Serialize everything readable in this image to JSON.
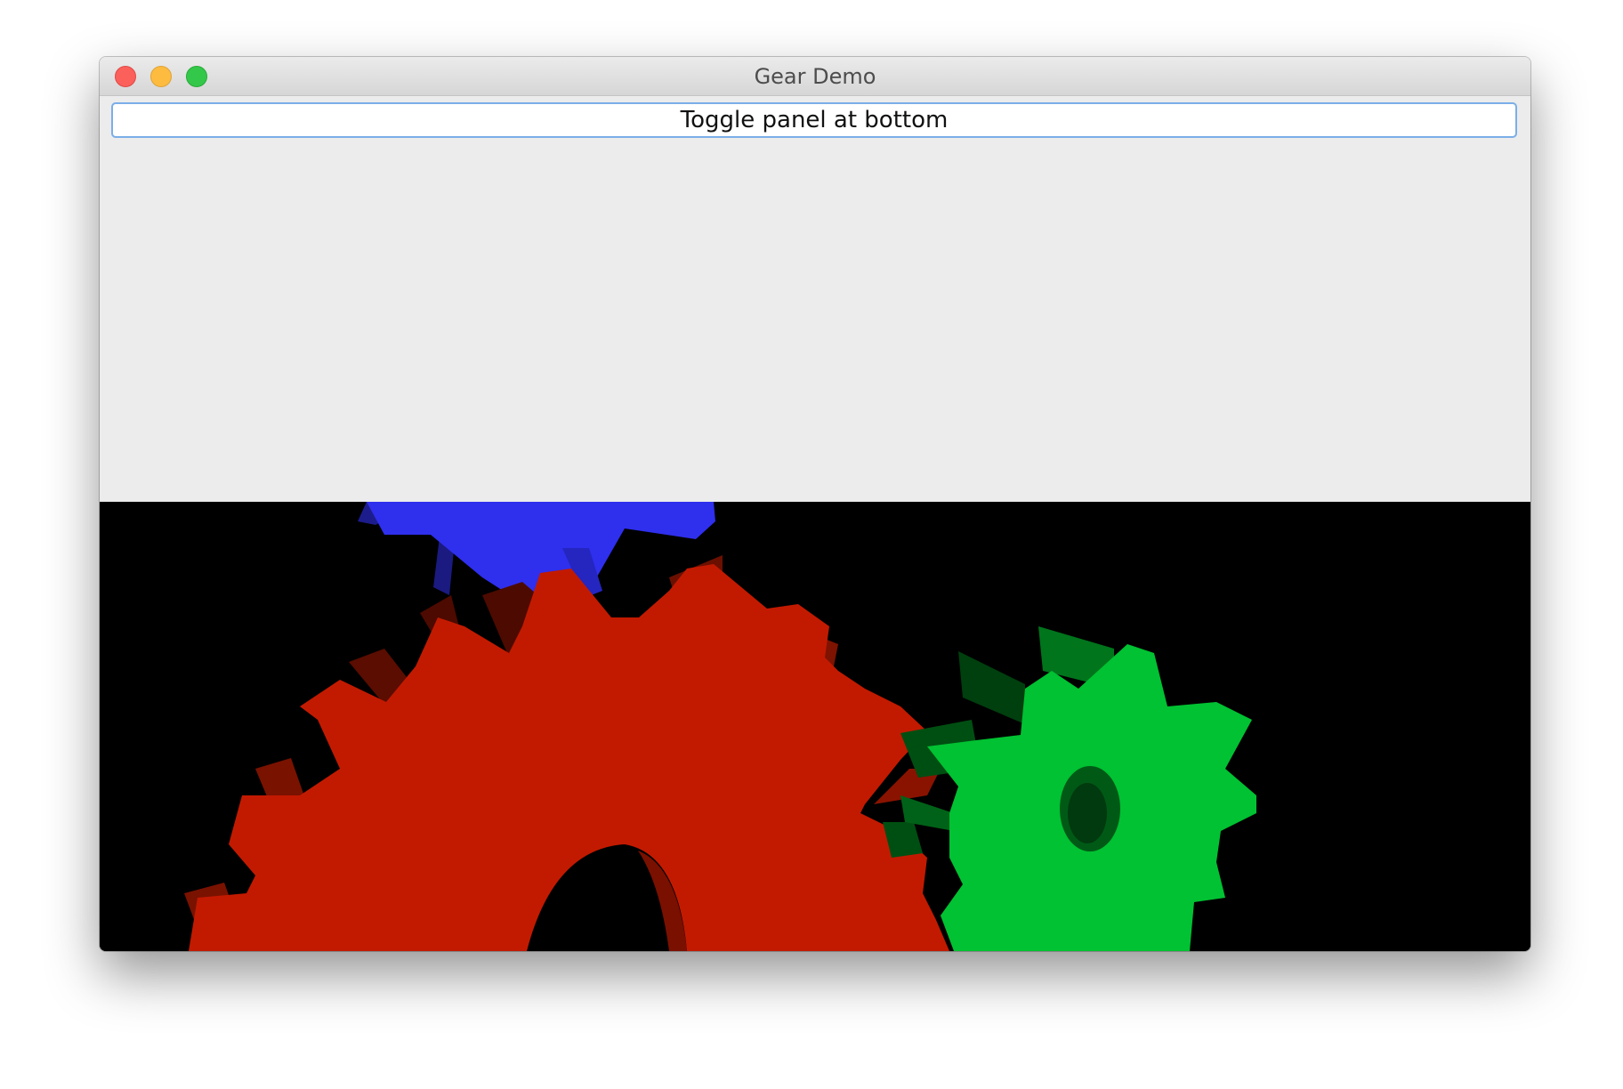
{
  "window": {
    "title": "Gear Demo",
    "controls": [
      "close",
      "minimize",
      "zoom"
    ]
  },
  "toolbar": {
    "toggle_label": "Toggle panel at bottom"
  },
  "canvas": {
    "background": "#000000",
    "gears": [
      {
        "name": "red-gear",
        "color": "#c21a00",
        "teeth": 20
      },
      {
        "name": "green-gear",
        "color": "#00c232",
        "teeth": 10
      },
      {
        "name": "blue-gear",
        "color": "#2f2fee",
        "teeth": 10
      }
    ]
  },
  "colors": {
    "panel": "#ececec",
    "button_focus_border": "#7aaee8",
    "close": "#fc605b",
    "minimize": "#fdbc40",
    "zoom": "#34c84a"
  }
}
